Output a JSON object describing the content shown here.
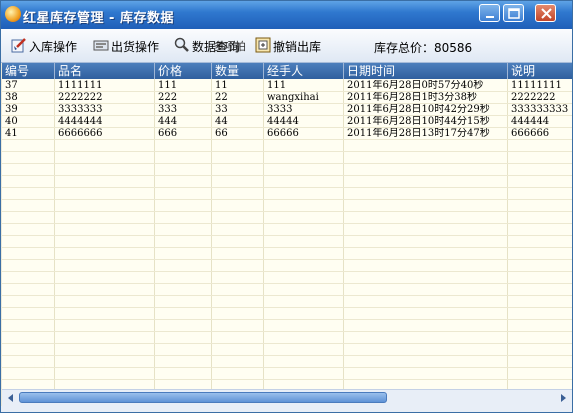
{
  "window": {
    "title": "红星库存管理 - 库存数据"
  },
  "toolbar": {
    "items": [
      {
        "label": "入库操作",
        "icon": "stock-in-icon"
      },
      {
        "label": "出货操作",
        "icon": "shipment-icon"
      },
      {
        "label": "数据查询",
        "icon": "search-icon"
      },
      {
        "label": "撤销出库",
        "icon": "undo-outbound-icon"
      }
    ],
    "overlap_text": "多项拍",
    "total_label": "库存总价：",
    "total_value": "80586"
  },
  "table": {
    "columns": [
      "编号",
      "品名",
      "价格",
      "数量",
      "经手人",
      "日期时间",
      "说明"
    ],
    "rows": [
      [
        "37",
        "1111111",
        "111",
        "11",
        "111",
        "2011年6月28日0时57分40秒",
        "11111111"
      ],
      [
        "38",
        "2222222",
        "222",
        "22",
        "wangxihai",
        "2011年6月28日1时3分38秒",
        "2222222"
      ],
      [
        "39",
        "3333333",
        "333",
        "33",
        "3333",
        "2011年6月28日10时42分29秒",
        "333333333"
      ],
      [
        "40",
        "4444444",
        "444",
        "44",
        "44444",
        "2011年6月28日10时44分15秒",
        "444444"
      ],
      [
        "41",
        "6666666",
        "666",
        "66",
        "66666",
        "2011年6月28日13时17分47秒",
        "666666"
      ]
    ]
  },
  "colors": {
    "title_bar": "#2f78cf",
    "header": "#3e6faf",
    "grid_background": "#fffef2"
  }
}
